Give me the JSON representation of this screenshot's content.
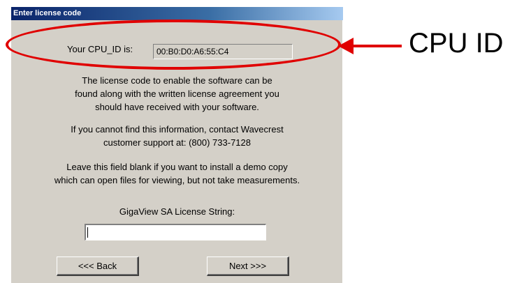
{
  "window": {
    "title": "Enter license code"
  },
  "cpu": {
    "label": "Your CPU_ID is:",
    "value": "00:B0:D0:A6:55:C4"
  },
  "paragraphs": {
    "p1": [
      "The license code to enable the software can be",
      "found along with the written license agreement you",
      "should have received with your software."
    ],
    "p2": [
      "If you cannot find this information, contact Wavecrest",
      "customer support at: (800) 733-7128"
    ],
    "p3": [
      "Leave this field blank if you want to install a demo copy",
      "which can open files for viewing, but not take measurements."
    ]
  },
  "license": {
    "label": "GigaView SA License String:",
    "value": ""
  },
  "buttons": {
    "back": "<<< Back",
    "next": "Next >>>"
  },
  "annotation": {
    "text": "CPU ID",
    "color": "#e00000"
  }
}
